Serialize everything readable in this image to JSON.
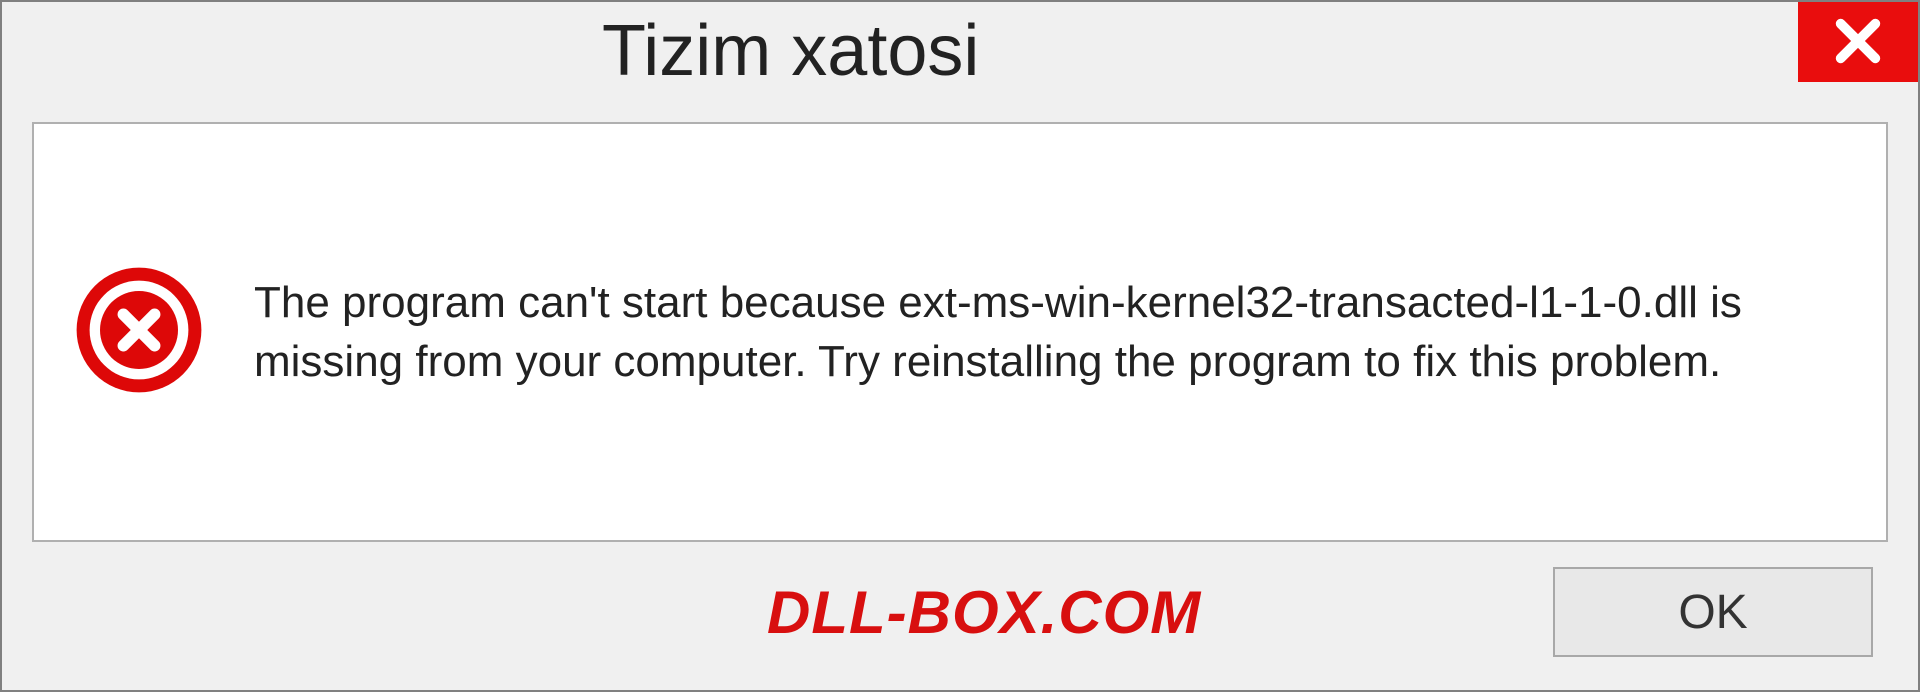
{
  "dialog": {
    "title": "Tizim xatosi",
    "message": "The program can't start because ext-ms-win-kernel32-transacted-l1-1-0.dll is missing from your computer. Try reinstalling the program to fix this problem.",
    "ok_label": "OK"
  },
  "watermark": "DLL-BOX.COM"
}
